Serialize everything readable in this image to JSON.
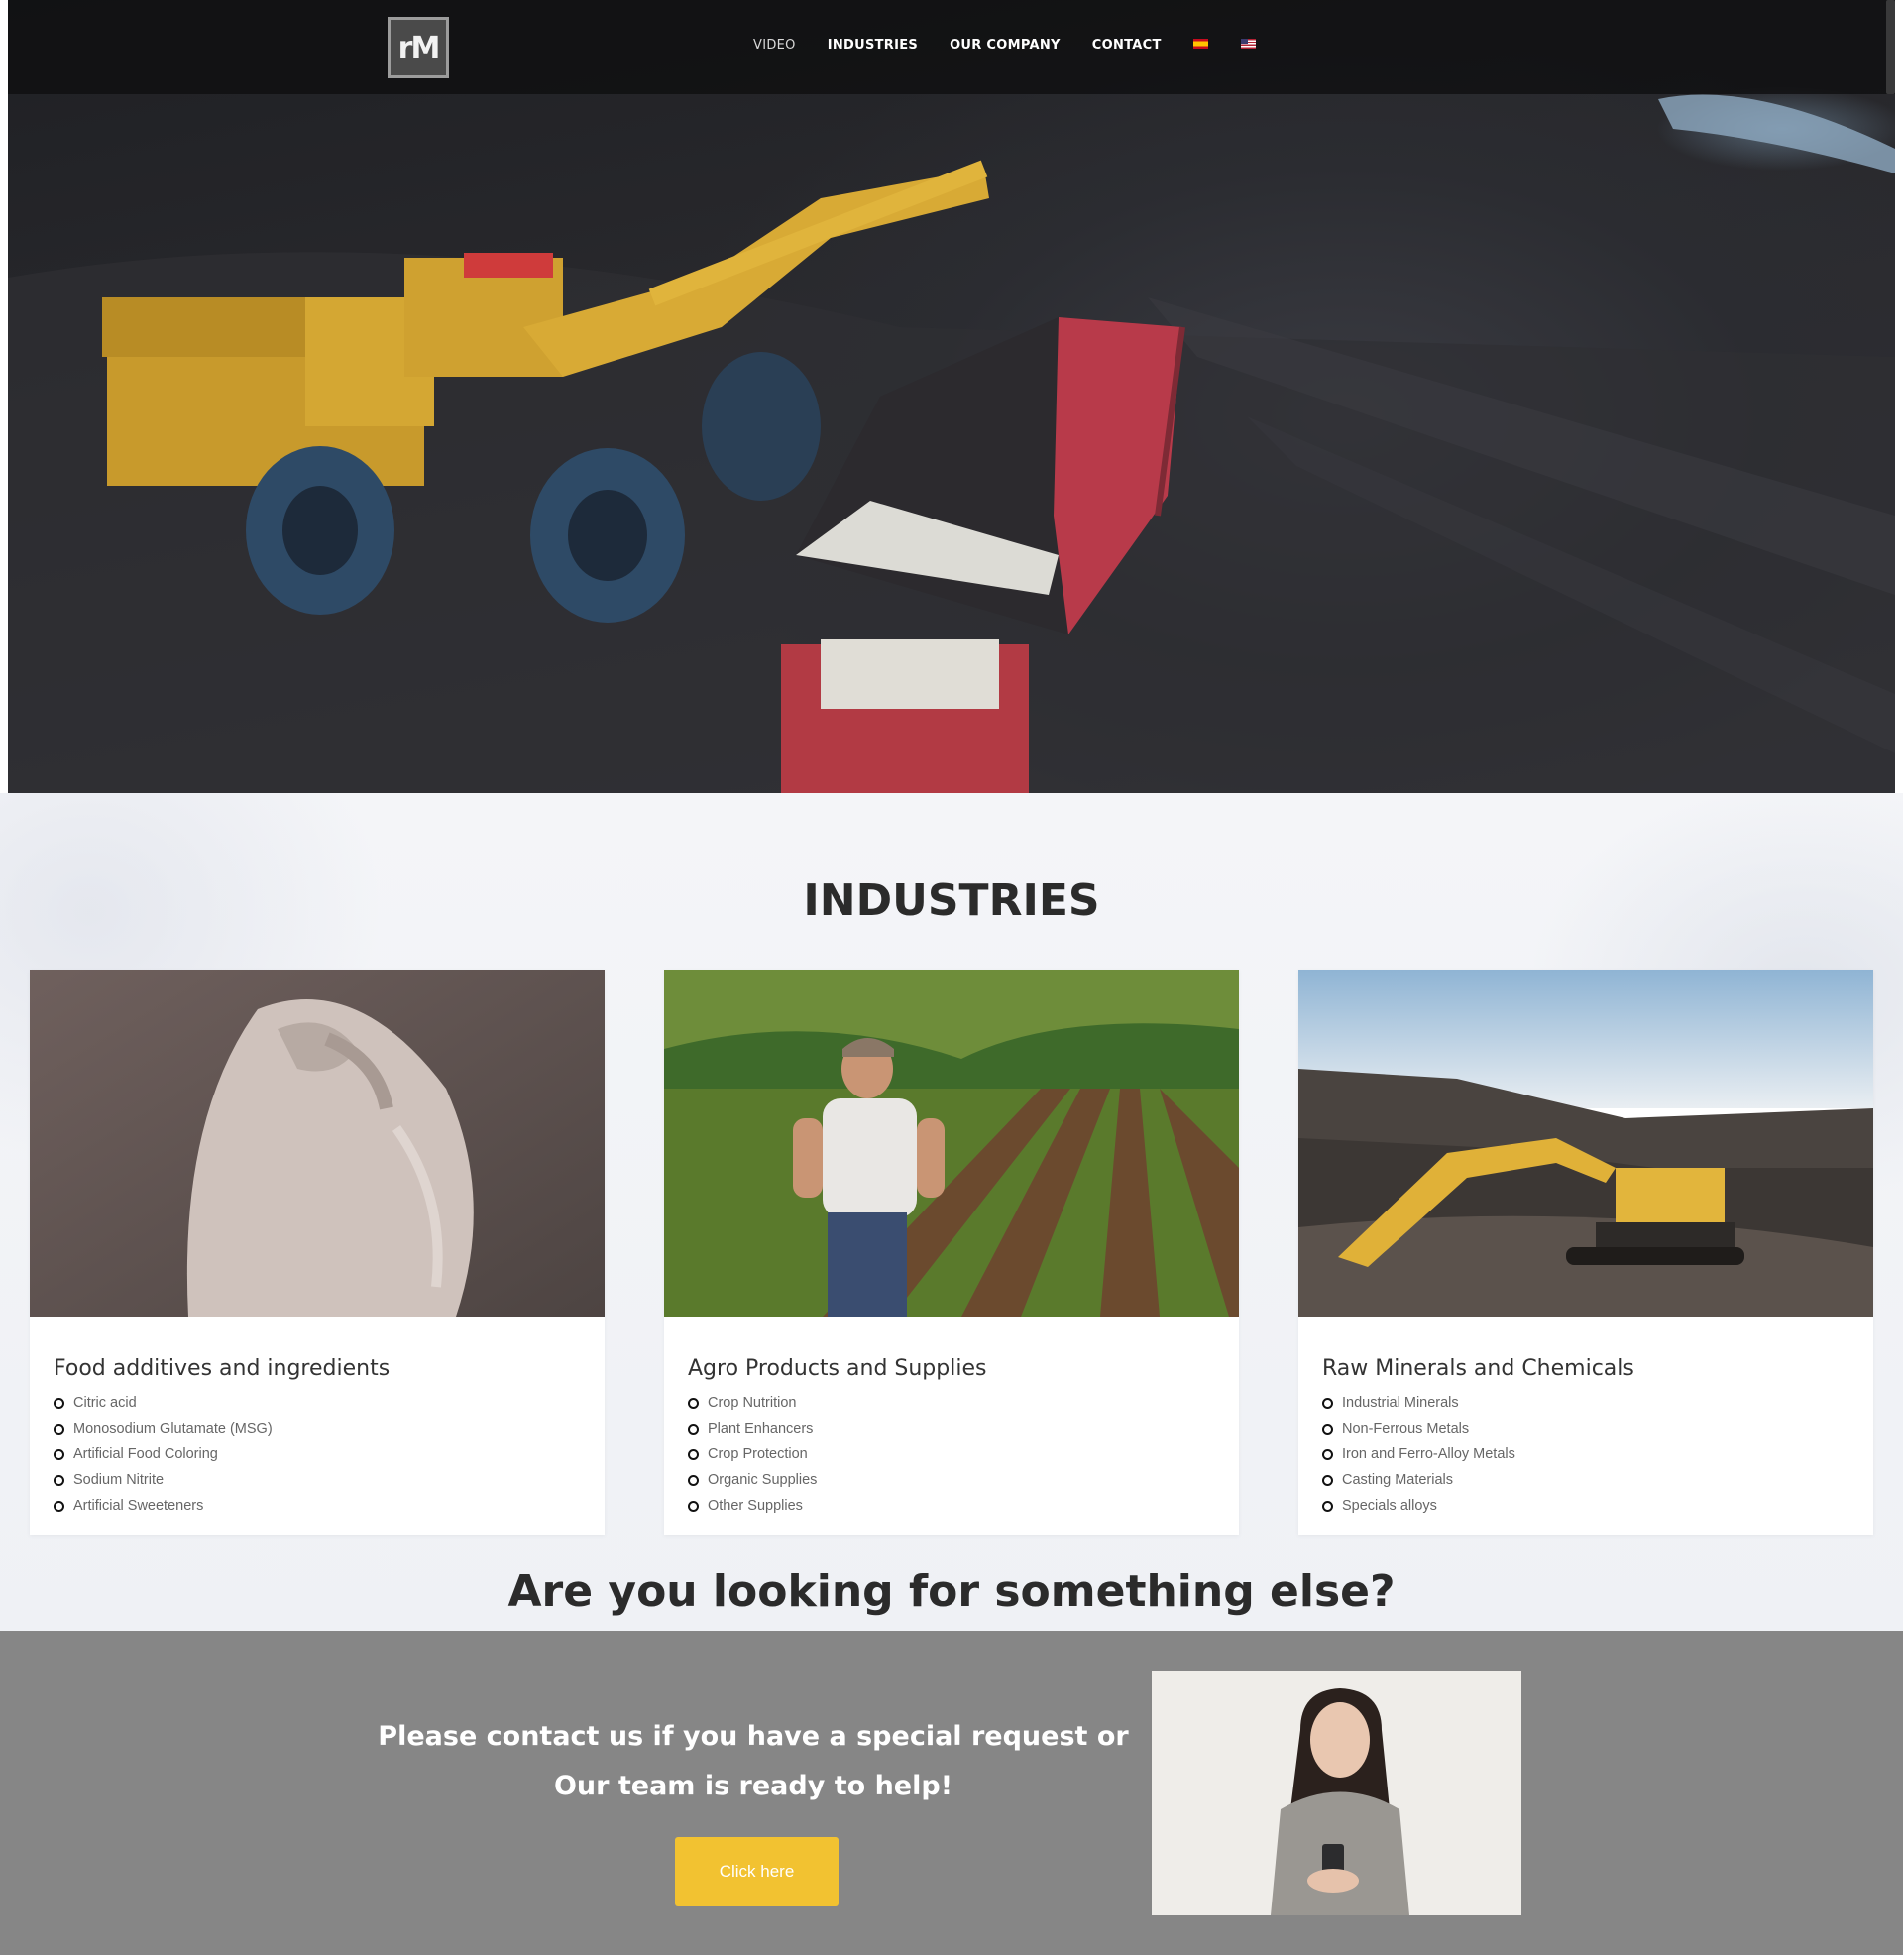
{
  "header": {
    "logo_text": "rM",
    "nav": [
      {
        "label": "VIDEO",
        "active": true
      },
      {
        "label": "INDUSTRIES",
        "active": false
      },
      {
        "label": "OUR COMPANY",
        "active": false
      },
      {
        "label": "CONTACT",
        "active": false
      }
    ],
    "languages": [
      "es-flag-icon",
      "us-flag-icon"
    ]
  },
  "hero": {
    "scene": "mining loader filling a dump truck"
  },
  "industries": {
    "title": "INDUSTRIES",
    "cards": [
      {
        "title": "Food additives and ingredients",
        "items": [
          "Citric acid",
          "Monosodium Glutamate (MSG)",
          "Artificial Food Coloring",
          "Sodium Nitrite",
          "Artificial Sweeteners"
        ]
      },
      {
        "title": "Agro Products and Supplies",
        "items": [
          "Crop Nutrition",
          "Plant Enhancers",
          "Crop Protection",
          "Organic Supplies",
          "Other Supplies"
        ]
      },
      {
        "title": "Raw Minerals and Chemicals",
        "items": [
          "Industrial Minerals",
          "Non-Ferrous Metals",
          "Iron and Ferro-Alloy Metals",
          "Casting Materials",
          "Specials alloys"
        ]
      }
    ]
  },
  "looking": {
    "title": "Are you looking for something else?"
  },
  "contact": {
    "line1": "Please contact us if you have a special request or",
    "line2": "Our team is ready to help!",
    "button_label": "Click here"
  },
  "colors": {
    "accent_button": "#f2c231",
    "contact_bg": "#868686",
    "header_bg": "#0e0e10"
  }
}
